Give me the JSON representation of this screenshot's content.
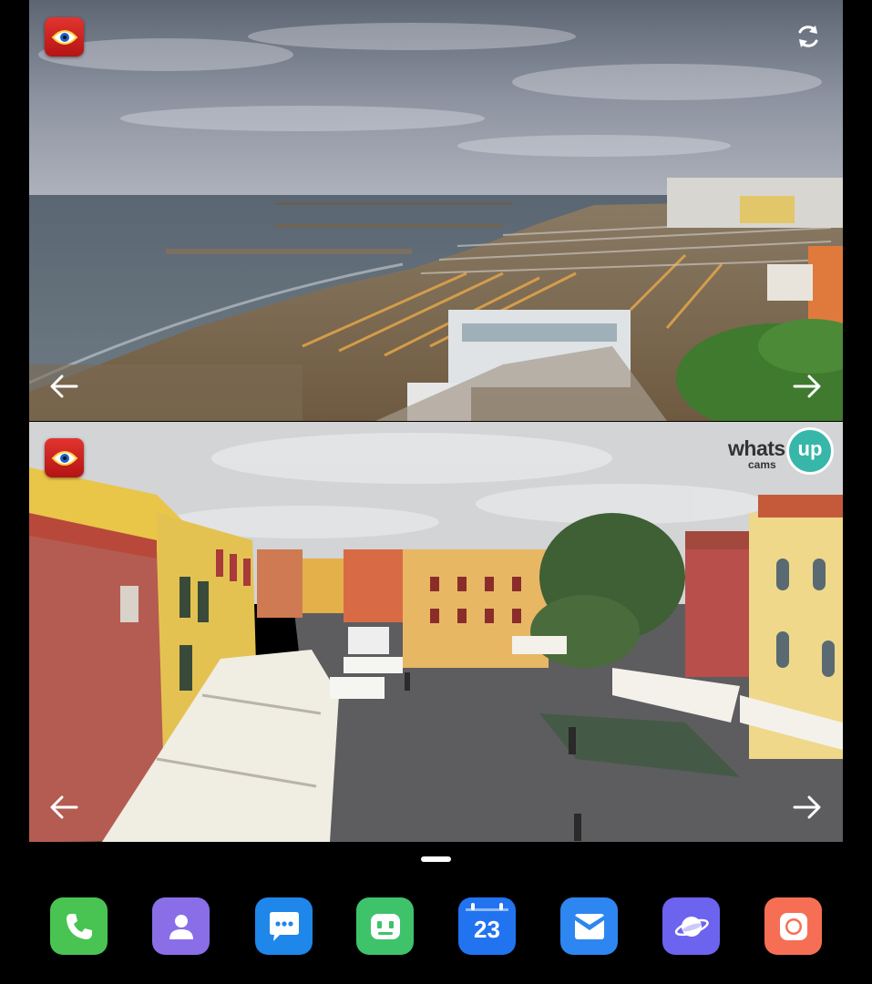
{
  "cameras": [
    {
      "title": "beach-webcam",
      "scene": "Seaside beach with rows of umbrellas, breakwaters and hotels under a cloudy sky"
    },
    {
      "title": "town-square-webcam",
      "scene": "Pedestrian town square with colorful buildings, white awnings and a tree"
    }
  ],
  "watermark": {
    "brand": "whatsup",
    "brand_top": "whats",
    "brand_bubble": "up",
    "sub": "cams"
  },
  "dock": {
    "apps": [
      {
        "name": "Phone",
        "color": "#49c452"
      },
      {
        "name": "Contacts",
        "color": "#8a6ee8"
      },
      {
        "name": "Messages",
        "color": "#1f86ea"
      },
      {
        "name": "Assistant",
        "color": "#3ec36a"
      },
      {
        "name": "Calendar",
        "color": "#2173f0",
        "day": "23"
      },
      {
        "name": "Email",
        "color": "#2e86f0"
      },
      {
        "name": "Internet",
        "color": "#6c63ee"
      },
      {
        "name": "Camera",
        "color": "#f66f55"
      }
    ]
  }
}
